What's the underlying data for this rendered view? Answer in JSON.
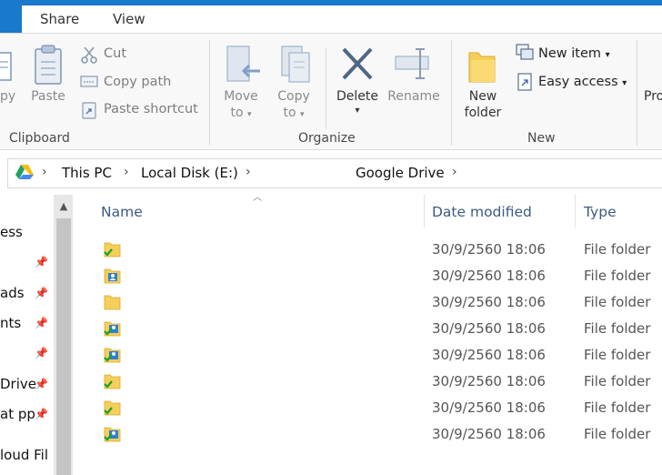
{
  "tabs": {
    "share": "Share",
    "view": "View"
  },
  "clipboard": {
    "copy": "py",
    "paste": "Paste",
    "cut": "Cut",
    "copy_path": "Copy path",
    "paste_shortcut": "Paste shortcut",
    "group": "Clipboard"
  },
  "organize": {
    "move_to": "Move",
    "move_to_sub": "to",
    "copy_to": "Copy",
    "copy_to_sub": "to",
    "delete": "Delete",
    "rename": "Rename",
    "group": "Organize"
  },
  "new": {
    "new_folder_1": "New",
    "new_folder_2": "folder",
    "new_item": "New item",
    "easy_access": "Easy access",
    "group": "New"
  },
  "open": {
    "properties_partial": "Pro"
  },
  "address": {
    "parts": [
      "This PC",
      "Local Disk (E:)",
      "Google Drive"
    ]
  },
  "nav": {
    "items": [
      "ess",
      "ads",
      "nts",
      "Drive",
      "at pp",
      "loud Fil"
    ]
  },
  "columns": {
    "name": "Name",
    "date": "Date modified",
    "type": "Type"
  },
  "files": [
    {
      "date": "30/9/2560 18:06",
      "type": "File folder",
      "icon": "folder-synced-icon"
    },
    {
      "date": "30/9/2560 18:06",
      "type": "File folder",
      "icon": "folder-shared-icon"
    },
    {
      "date": "30/9/2560 18:06",
      "type": "File folder",
      "icon": "folder-icon"
    },
    {
      "date": "30/9/2560 18:06",
      "type": "File folder",
      "icon": "folder-shared-synced-icon"
    },
    {
      "date": "30/9/2560 18:06",
      "type": "File folder",
      "icon": "folder-shared-synced-icon"
    },
    {
      "date": "30/9/2560 18:06",
      "type": "File folder",
      "icon": "folder-synced-icon"
    },
    {
      "date": "30/9/2560 18:06",
      "type": "File folder",
      "icon": "folder-synced-icon"
    },
    {
      "date": "30/9/2560 18:06",
      "type": "File folder",
      "icon": "folder-shared-synced-icon"
    }
  ],
  "colors": {
    "accent": "#1979ca",
    "header_text": "#3d5a80",
    "folder": "#f5cf5a",
    "sync_check": "#19a02b"
  }
}
